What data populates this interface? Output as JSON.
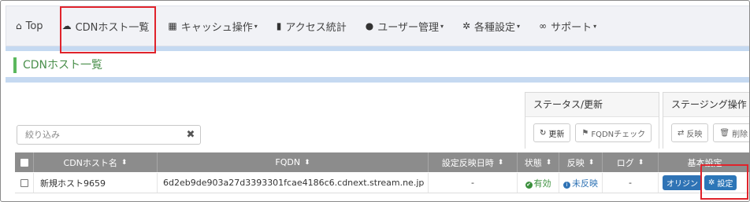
{
  "nav": {
    "items": [
      {
        "label": "Top",
        "icon": "home-icon",
        "glyph": "⌂",
        "caret": ""
      },
      {
        "label": "CDNホスト一覧",
        "icon": "cloud-icon",
        "glyph": "☁",
        "caret": ""
      },
      {
        "label": "キャッシュ操作",
        "icon": "grid-icon",
        "glyph": "▦",
        "caret": "▾"
      },
      {
        "label": "アクセス統計",
        "icon": "bar-chart-icon",
        "glyph": "▮",
        "caret": ""
      },
      {
        "label": "ユーザー管理",
        "icon": "user-icon",
        "glyph": "●",
        "caret": "▾"
      },
      {
        "label": "各種設定",
        "icon": "gear-icon",
        "glyph": "✲",
        "caret": "▾"
      },
      {
        "label": "サポート",
        "icon": "link-icon",
        "glyph": "∞",
        "caret": "▾"
      }
    ]
  },
  "page": {
    "title": "CDNホスト一覧"
  },
  "filter": {
    "placeholder": "絞り込み",
    "clear_glyph": "✖"
  },
  "status_group": {
    "header": "ステータス/更新",
    "update_label": "更新",
    "update_glyph": "↻",
    "fqdn_check_label": "FQDNチェック",
    "fqdn_check_glyph": "⚑"
  },
  "staging_group": {
    "header": "ステージング操作",
    "reflect_label": "反映",
    "reflect_glyph": "⇄",
    "delete_label": "削除",
    "delete_glyph": "🗑"
  },
  "table": {
    "sort_glyph": "⬍",
    "headers": {
      "host_name": "CDNホスト名",
      "fqdn": "FQDN",
      "applied_at": "設定反映日時",
      "status": "状態",
      "reflect": "反映",
      "log": "ログ",
      "basic_settings": "基本設定"
    },
    "rows": [
      {
        "host_name": "新規ホスト9659",
        "fqdn": "6d2eb9de903a27d3393301fcae4186c6.cdnext.stream.ne.jp",
        "applied_at": "-",
        "status": "有効",
        "status_glyph": "✔",
        "reflect": "未反映",
        "reflect_glyph": "i",
        "log": "-",
        "origin_label": "オリジン",
        "settings_label": "設定",
        "settings_glyph": "✲"
      }
    ]
  },
  "colors": {
    "highlight": "#e0232b",
    "nav_bg": "#f1f2f6",
    "band": "#c5d9f1",
    "title_green": "#4a8f4b",
    "table_header": "#8c8c8c",
    "origin_button": "#2f73b5",
    "settings_button": "#2c76b8"
  }
}
